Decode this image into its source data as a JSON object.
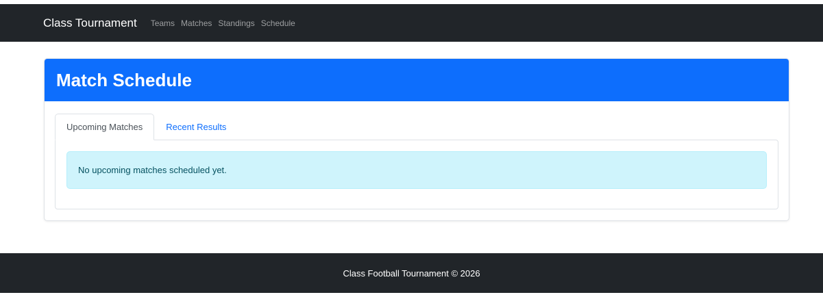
{
  "navbar": {
    "brand": "Class Tournament",
    "links": [
      {
        "label": "Teams"
      },
      {
        "label": "Matches"
      },
      {
        "label": "Standings"
      },
      {
        "label": "Schedule"
      }
    ]
  },
  "card": {
    "title": "Match Schedule",
    "tabs": [
      {
        "label": "Upcoming Matches",
        "active": true
      },
      {
        "label": "Recent Results",
        "active": false
      }
    ],
    "alert_text": "No upcoming matches scheduled yet."
  },
  "footer": {
    "text": "Class Football Tournament © 2026"
  },
  "colors": {
    "navbar_bg": "#212529",
    "header_bg": "#0d6efd",
    "alert_bg": "#cff4fc",
    "link": "#0d6efd"
  }
}
